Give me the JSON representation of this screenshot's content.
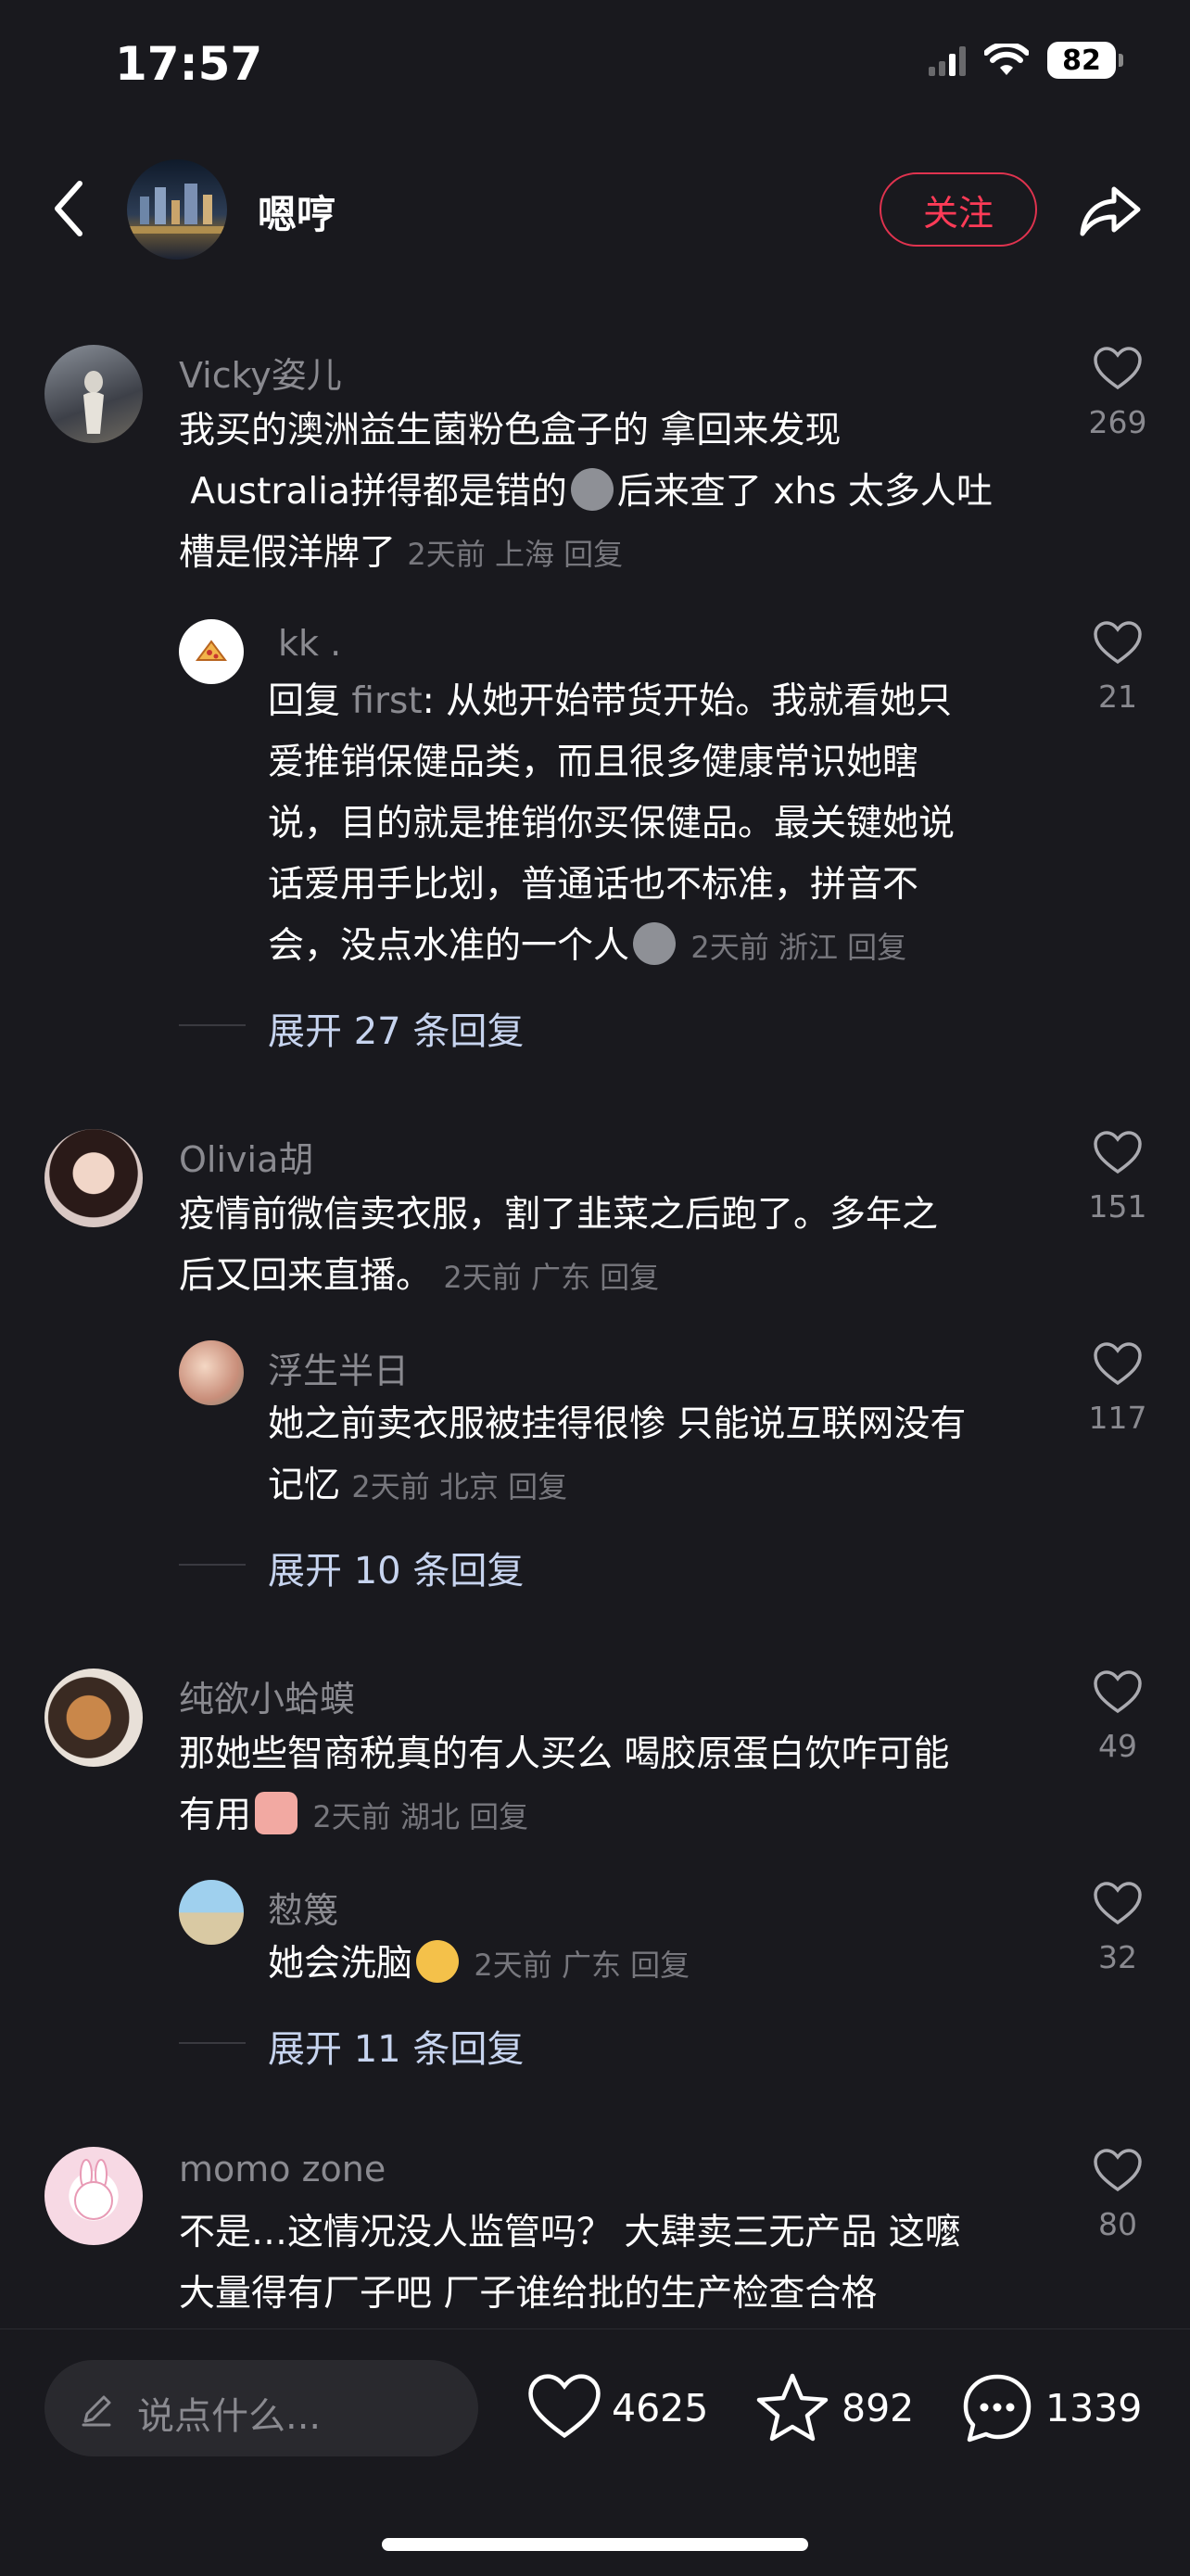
{
  "status_bar": {
    "time": "17:57",
    "battery": "82"
  },
  "header": {
    "name": "嗯哼",
    "follow_label": "关注"
  },
  "comments": [
    {
      "user": "Vicky姿儿",
      "text_lines": [
        "我买的澳洲益生菌粉色盒子的 拿回来发现",
        "Australia拼得都是错的",
        "后来查了 xhs 太多人吐",
        "槽是假洋牌了"
      ],
      "meta": "2天前 上海 回复",
      "likes": "269",
      "reply": {
        "user": "kk .",
        "prefix": "回复",
        "mention": "first",
        "text_lines": [
          ": 从她开始带货开始。我就看她只",
          "爱推销保健品类，而且很多健康常识她瞎",
          "说，目的就是推销你买保健品。最关键她说",
          "话爱用手比划，普通话也不标准，拼音不",
          "会，没点水准的一个人"
        ],
        "meta": "2天前 浙江 回复",
        "likes": "21"
      },
      "expand": "展开 27 条回复"
    },
    {
      "user": "Olivia胡",
      "text_lines": [
        "疫情前微信卖衣服，割了韭菜之后跑了。多年之",
        "后又回来直播。"
      ],
      "meta": "2天前 广东 回复",
      "likes": "151",
      "reply": {
        "user": "浮生半日",
        "text_lines": [
          "她之前卖衣服被挂得很惨 只能说互联网没有",
          "记忆"
        ],
        "meta": "2天前 北京 回复",
        "likes": "117"
      },
      "expand": "展开 10 条回复"
    },
    {
      "user": "纯欲小蛤蟆",
      "text_lines": [
        "那她些智商税真的有人买么 喝胶原蛋白饮咋可能",
        "有用"
      ],
      "meta": "2天前 湖北 回复",
      "likes": "49",
      "reply": {
        "user": "愸篾",
        "text_lines": [
          "她会洗脑"
        ],
        "meta": "2天前 广东 回复",
        "likes": "32"
      },
      "expand": "展开 11 条回复"
    },
    {
      "user": "momo zone",
      "text_lines": [
        "不是…这情况没人监管吗？ 大肆卖三无产品 这嚒",
        "大量得有厂子吧 厂子谁给批的生产检查合格"
      ],
      "likes": "80"
    }
  ],
  "bottom_bar": {
    "placeholder": "说点什么...",
    "likes": "4625",
    "favorites": "892",
    "comments": "1339"
  },
  "icons": [
    "back-arrow-icon",
    "share-icon",
    "heart-icon",
    "star-icon",
    "comment-bubble-icon",
    "pencil-icon",
    "wifi-icon",
    "signal-icon",
    "battery-icon"
  ],
  "colors": {
    "background": "#19191e",
    "accent": "#ff3b57",
    "expand_text": "#c7d4ef"
  }
}
